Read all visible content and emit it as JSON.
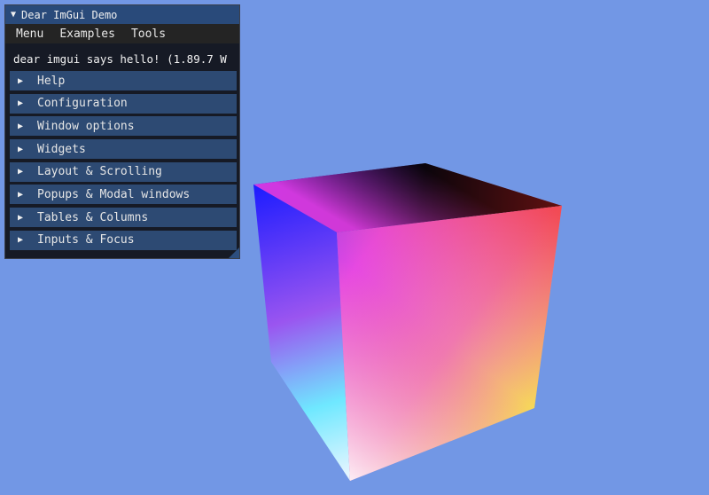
{
  "window": {
    "title": "Dear ImGui Demo",
    "title_arrow": "▼",
    "menu": [
      "Menu",
      "Examples",
      "Tools"
    ],
    "hello_text": "dear imgui says hello! (1.89.7 W",
    "headers": [
      {
        "arrow": "▶",
        "label": "Help"
      },
      {
        "arrow": "▶",
        "label": "Configuration"
      },
      {
        "arrow": "▶",
        "label": "Window options"
      },
      {
        "arrow": "▶",
        "label": "Widgets"
      },
      {
        "arrow": "▶",
        "label": "Layout & Scrolling"
      },
      {
        "arrow": "▶",
        "label": "Popups & Modal windows"
      },
      {
        "arrow": "▶",
        "label": "Tables & Columns"
      },
      {
        "arrow": "▶",
        "label": "Inputs & Focus"
      }
    ]
  },
  "scene": {
    "background_color": "#7297e5",
    "object": "rgb-color-cube"
  }
}
